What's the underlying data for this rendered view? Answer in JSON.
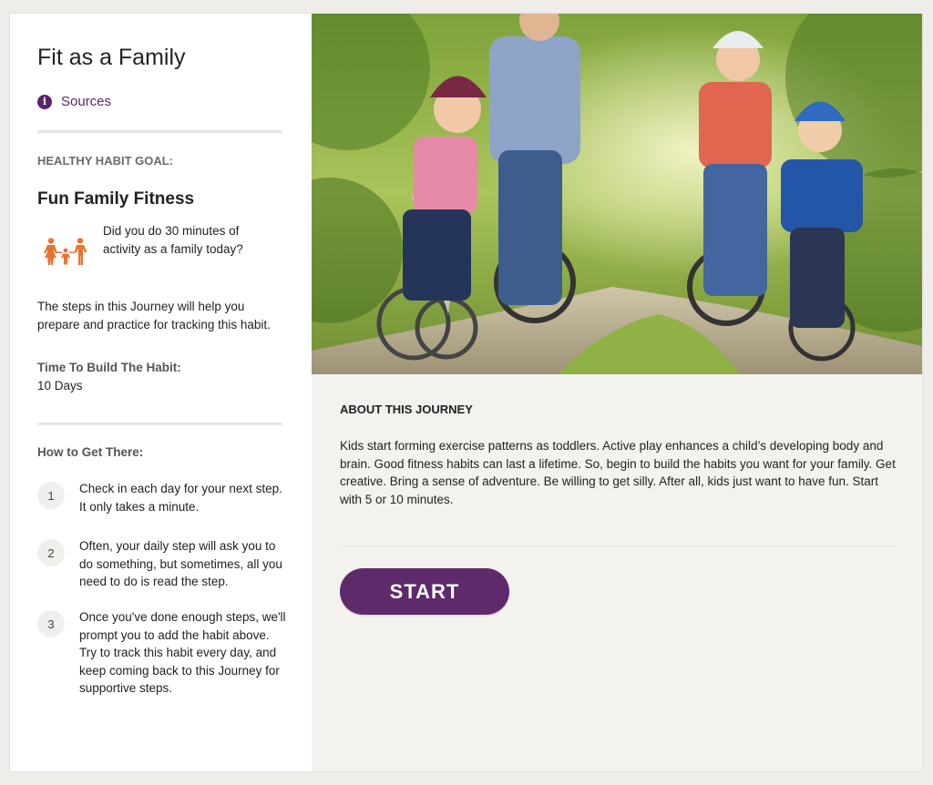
{
  "left_panel": {
    "title": "Fit as a Family",
    "sources_label": "Sources",
    "goal_section_label": "HEALTHY HABIT GOAL:",
    "goal_title": "Fun Family Fitness",
    "goal_question": "Did you do 30 minutes of activity as a family today?",
    "journey_description": "The steps in this Journey will help you prepare and practice for tracking this habit.",
    "time_label": "Time To Build The Habit:",
    "time_value": "10 Days",
    "how_label": "How to Get There:",
    "steps": [
      {
        "number": "1",
        "text": "Check in each day for your next step. It only takes a minute."
      },
      {
        "number": "2",
        "text": "Often, your daily step will ask you to do something, but sometimes, all you need to do is read the step."
      },
      {
        "number": "3",
        "text": "Once you've done enough steps, we'll prompt you to add the habit above. Try to track this habit every day, and keep coming back to this Journey for supportive steps."
      }
    ]
  },
  "right_panel": {
    "about_heading": "ABOUT THIS JOURNEY",
    "about_text": "Kids start forming exercise patterns as toddlers.  Active play enhances a child’s developing body and brain. Good fitness habits can last a lifetime. So, begin to build the habits you want for your family. Get creative. Bring a sense of adventure. Be willing to get silly. After all, kids just want to have fun. Start with 5 or 10 minutes.",
    "start_label": "START"
  },
  "icons": {
    "sources": "info-icon",
    "goal": "family-icon"
  },
  "colors": {
    "accent_purple": "#5e2a6a",
    "family_icon_orange": "#e8732f",
    "panel_background": "#f3f2ef"
  }
}
